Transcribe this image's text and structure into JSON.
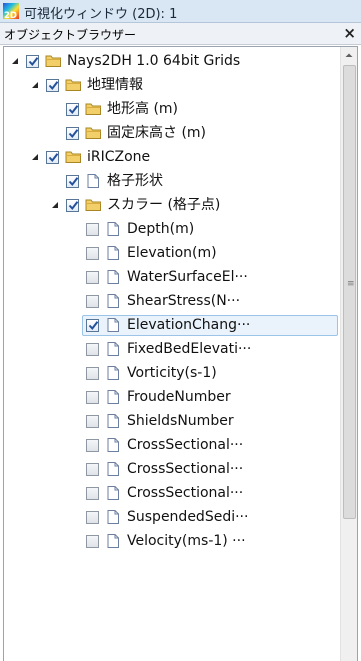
{
  "window": {
    "title": "可視化ウィンドウ (2D): 1",
    "icon": "app-2d-icon",
    "icon_text": "2D"
  },
  "panel": {
    "title": "オブジェクトブラウザー",
    "close_label": "×"
  },
  "tree": [
    {
      "label": "Nays2DH 1.0 64bit Grids",
      "depth": 0,
      "expander": "expanded",
      "checked": true,
      "icon": "folder-icon"
    },
    {
      "label": "地理情報",
      "depth": 1,
      "expander": "expanded",
      "checked": true,
      "icon": "folder-icon"
    },
    {
      "label": "地形高 (m)",
      "depth": 2,
      "expander": "none",
      "checked": true,
      "icon": "folder-icon"
    },
    {
      "label": "固定床高さ (m)",
      "depth": 2,
      "expander": "none",
      "checked": true,
      "icon": "folder-icon"
    },
    {
      "label": "iRICZone",
      "depth": 1,
      "expander": "expanded",
      "checked": true,
      "icon": "folder-icon"
    },
    {
      "label": "格子形状",
      "depth": 2,
      "expander": "none",
      "checked": true,
      "icon": "document-icon"
    },
    {
      "label": "スカラー (格子点)",
      "depth": 2,
      "expander": "expanded",
      "checked": true,
      "icon": "folder-icon"
    },
    {
      "label": "Depth(m)",
      "depth": 3,
      "expander": "none",
      "checked": false,
      "icon": "document-icon"
    },
    {
      "label": "Elevation(m)",
      "depth": 3,
      "expander": "none",
      "checked": false,
      "icon": "document-icon"
    },
    {
      "label": "WaterSurfaceEl···",
      "depth": 3,
      "expander": "none",
      "checked": false,
      "icon": "document-icon"
    },
    {
      "label": "ShearStress(N···",
      "depth": 3,
      "expander": "none",
      "checked": false,
      "icon": "document-icon"
    },
    {
      "label": "ElevationChang···",
      "depth": 3,
      "expander": "none",
      "checked": true,
      "icon": "document-icon",
      "selected": true
    },
    {
      "label": "FixedBedElevati···",
      "depth": 3,
      "expander": "none",
      "checked": false,
      "icon": "document-icon"
    },
    {
      "label": "Vorticity(s-1)",
      "depth": 3,
      "expander": "none",
      "checked": false,
      "icon": "document-icon"
    },
    {
      "label": "FroudeNumber",
      "depth": 3,
      "expander": "none",
      "checked": false,
      "icon": "document-icon"
    },
    {
      "label": "ShieldsNumber",
      "depth": 3,
      "expander": "none",
      "checked": false,
      "icon": "document-icon"
    },
    {
      "label": "CrossSectional···",
      "depth": 3,
      "expander": "none",
      "checked": false,
      "icon": "document-icon"
    },
    {
      "label": "CrossSectional···",
      "depth": 3,
      "expander": "none",
      "checked": false,
      "icon": "document-icon"
    },
    {
      "label": "CrossSectional···",
      "depth": 3,
      "expander": "none",
      "checked": false,
      "icon": "document-icon"
    },
    {
      "label": "SuspendedSedi···",
      "depth": 3,
      "expander": "none",
      "checked": false,
      "icon": "document-icon"
    },
    {
      "label": "Velocity(ms-1) ···",
      "depth": 3,
      "expander": "none",
      "checked": false,
      "icon": "document-icon"
    }
  ],
  "scrollbar": {
    "icon": "scroll-up-arrow-icon",
    "position": "top"
  },
  "colors": {
    "folder": "#f3cf6a",
    "selected_outline": "#9cc3e8",
    "selected_fill": "#eaf3fc"
  }
}
